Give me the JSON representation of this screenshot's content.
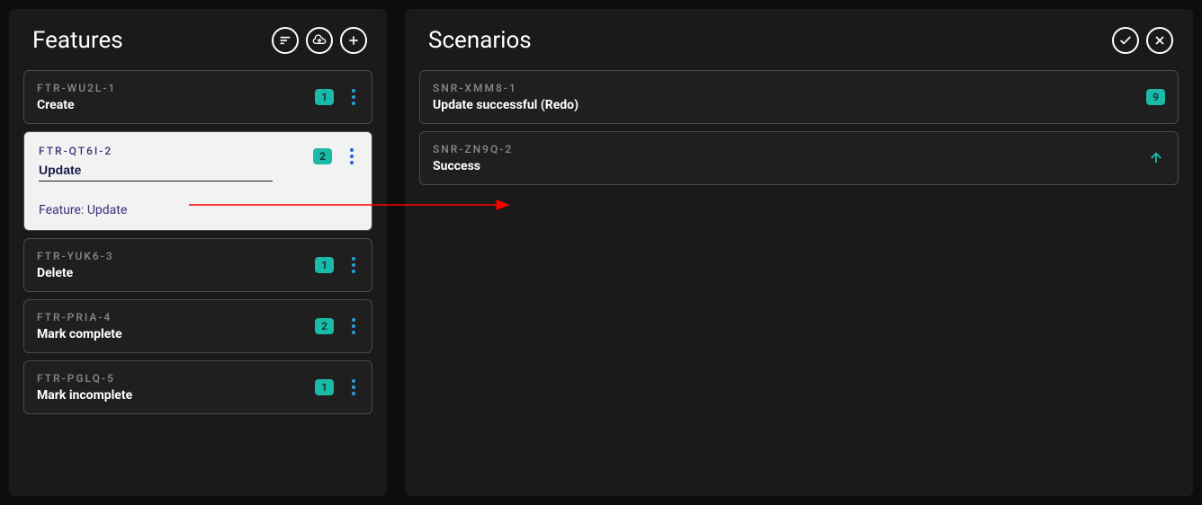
{
  "panels": {
    "features": {
      "title": "Features"
    },
    "scenarios": {
      "title": "Scenarios"
    }
  },
  "features": [
    {
      "id": "FTR-WU2L-1",
      "title": "Create",
      "count": "1"
    },
    {
      "id": "FTR-QT6I-2",
      "title": "Update",
      "count": "2",
      "selected": true,
      "inputValue": "Update",
      "featureLabel": "Feature: Update"
    },
    {
      "id": "FTR-YUK6-3",
      "title": "Delete",
      "count": "1"
    },
    {
      "id": "FTR-PRIA-4",
      "title": "Mark complete",
      "count": "2"
    },
    {
      "id": "FTR-PGLQ-5",
      "title": "Mark incomplete",
      "count": "1"
    }
  ],
  "scenarios": [
    {
      "id": "SNR-XMM8-1",
      "title": "Update successful (Redo)",
      "badge": "9"
    },
    {
      "id": "SNR-ZN9Q-2",
      "title": "Success",
      "moveUp": true
    }
  ]
}
